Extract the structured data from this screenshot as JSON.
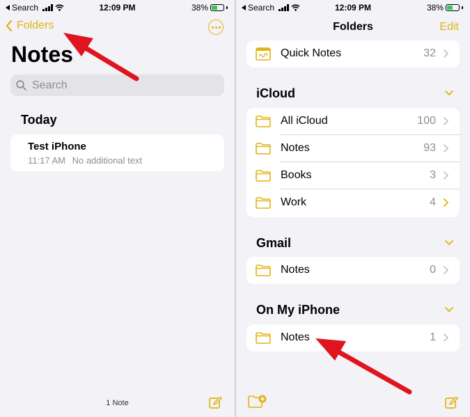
{
  "status_bar": {
    "back_label": "Search",
    "time": "12:09 PM",
    "battery": "38%"
  },
  "left": {
    "back_label": "Folders",
    "title": "Notes",
    "search_placeholder": "Search",
    "section": "Today",
    "note": {
      "title": "Test iPhone",
      "time": "11:17 AM",
      "preview": "No additional text"
    },
    "footer_count": "1 Note"
  },
  "right": {
    "title": "Folders",
    "edit_label": "Edit",
    "quick_notes": {
      "label": "Quick Notes",
      "count": "32"
    },
    "icloud": {
      "header": "iCloud",
      "items": [
        {
          "label": "All iCloud",
          "count": "100"
        },
        {
          "label": "Notes",
          "count": "93"
        },
        {
          "label": "Books",
          "count": "3"
        },
        {
          "label": "Work",
          "count": "4"
        }
      ]
    },
    "gmail": {
      "header": "Gmail",
      "items": [
        {
          "label": "Notes",
          "count": "0"
        }
      ]
    },
    "on_my_iphone": {
      "header": "On My iPhone",
      "items": [
        {
          "label": "Notes",
          "count": "1"
        }
      ]
    }
  },
  "colors": {
    "accent": "#e2b411",
    "arrow": "#e0141e",
    "background": "#f2f2f7"
  }
}
